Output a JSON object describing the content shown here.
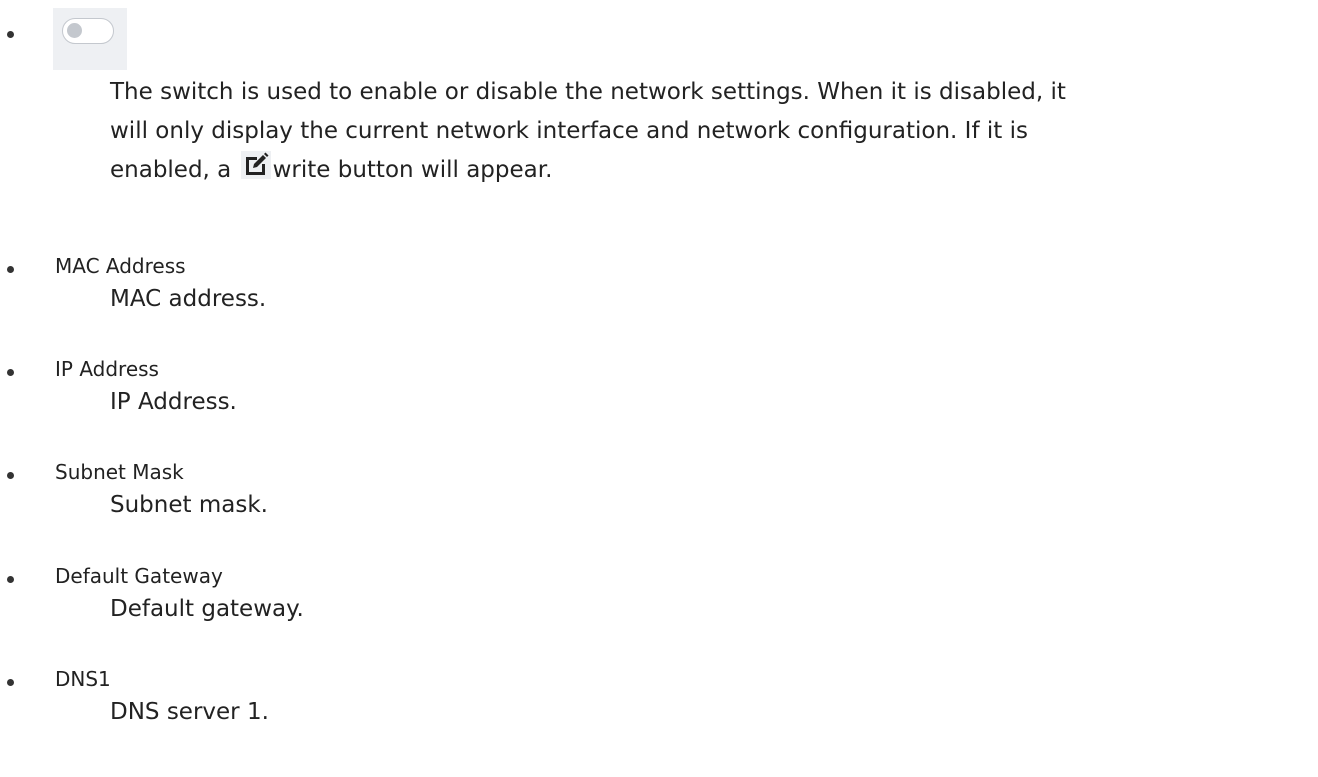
{
  "switch": {
    "enabled": false
  },
  "switch_description": {
    "line1": "The switch is used to enable or disable the network settings. When it is disabled, it",
    "line2": "will only display the current network interface and network configuration. If it is",
    "line3_before": "enabled, a",
    "line3_after": "write button will appear."
  },
  "items": [
    {
      "term": "MAC Address",
      "desc": "MAC address."
    },
    {
      "term": "IP Address",
      "desc": "IP Address."
    },
    {
      "term": "Subnet Mask",
      "desc": "Subnet mask."
    },
    {
      "term": "Default Gateway",
      "desc": "Default gateway."
    },
    {
      "term": "DNS1",
      "desc": "DNS server 1."
    }
  ],
  "icons": {
    "edit": "edit-icon"
  },
  "colors": {
    "switch_bg": "#eef0f3",
    "switch_border": "#c4c8ce",
    "text": "#222222"
  }
}
